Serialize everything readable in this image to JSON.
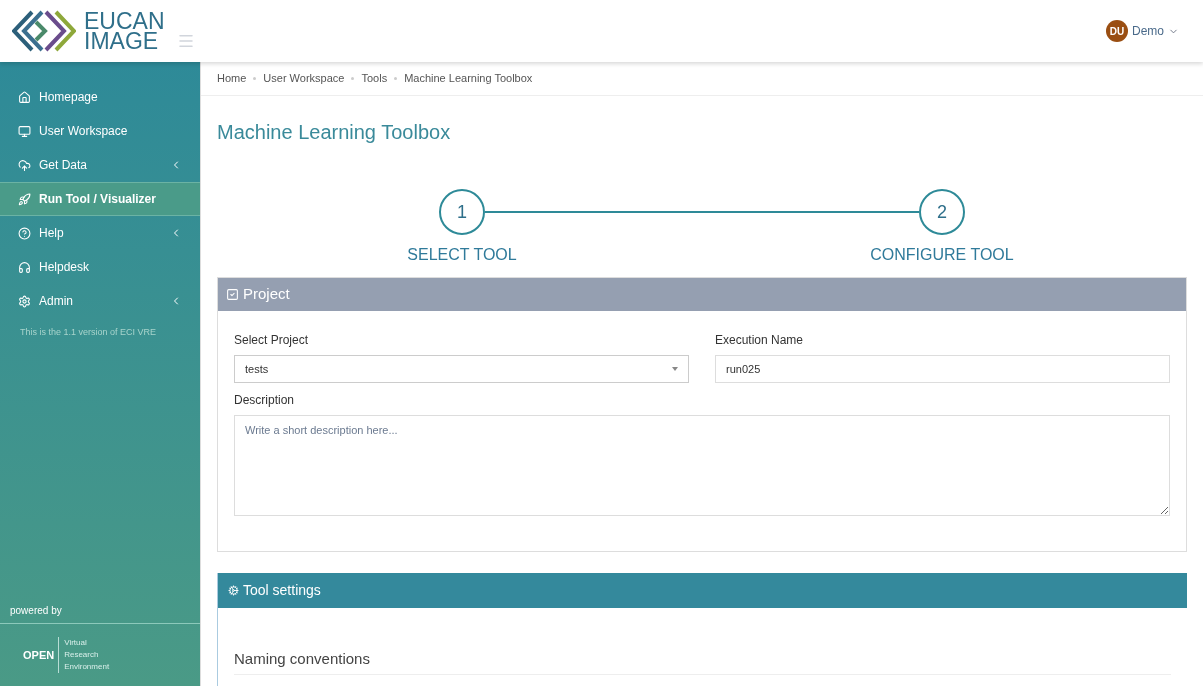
{
  "header": {
    "logo": {
      "line1": "EUCAN",
      "line2": "IMAGE"
    },
    "user": {
      "initials": "DU",
      "name": "Demo"
    }
  },
  "sidebar": {
    "items": [
      {
        "label": "Homepage",
        "selected": false,
        "has_submenu": false
      },
      {
        "label": "User Workspace",
        "selected": false,
        "has_submenu": false
      },
      {
        "label": "Get Data",
        "selected": false,
        "has_submenu": true
      },
      {
        "label": "Run Tool / Visualizer",
        "selected": true,
        "has_submenu": false
      },
      {
        "label": "Help",
        "selected": false,
        "has_submenu": true
      },
      {
        "label": "Helpdesk",
        "selected": false,
        "has_submenu": false
      },
      {
        "label": "Admin",
        "selected": false,
        "has_submenu": true
      }
    ],
    "version_note": "This is the 1.1 version of ECI VRE",
    "powered_by": "powered by",
    "footer_logo": {
      "word": "OPEN",
      "lines": [
        "Virtual",
        "Research",
        "Environment"
      ]
    }
  },
  "breadcrumb": [
    "Home",
    "User Workspace",
    "Tools",
    "Machine Learning Toolbox"
  ],
  "page_title": "Machine Learning Toolbox",
  "steps": [
    {
      "number": "1",
      "label": "SELECT TOOL"
    },
    {
      "number": "2",
      "label": "CONFIGURE TOOL"
    }
  ],
  "project_panel": {
    "title": "Project",
    "select_project": {
      "label": "Select Project",
      "value": "tests"
    },
    "execution_name": {
      "label": "Execution Name",
      "value": "run025"
    },
    "description": {
      "label": "Description",
      "placeholder": "Write a short description here..."
    }
  },
  "tool_settings_panel": {
    "title": "Tool settings",
    "section_title": "Naming conventions"
  }
}
